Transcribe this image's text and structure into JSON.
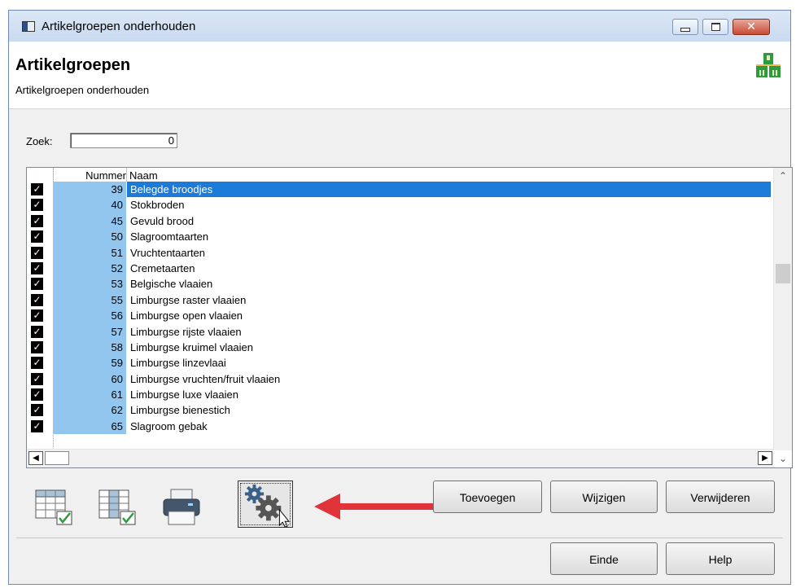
{
  "window": {
    "title": "Artikelgroepen onderhouden"
  },
  "header": {
    "title": "Artikelgroepen",
    "subtitle": "Artikelgroepen onderhouden"
  },
  "search": {
    "label": "Zoek:",
    "value": "0"
  },
  "table": {
    "columns": [
      "Nummer",
      "Naam"
    ],
    "rows": [
      {
        "checked": true,
        "nummer": "39",
        "naam": "Belegde broodjes",
        "selected": true
      },
      {
        "checked": true,
        "nummer": "40",
        "naam": "Stokbroden"
      },
      {
        "checked": true,
        "nummer": "45",
        "naam": "Gevuld brood"
      },
      {
        "checked": true,
        "nummer": "50",
        "naam": "Slagroomtaarten"
      },
      {
        "checked": true,
        "nummer": "51",
        "naam": "Vruchtentaarten"
      },
      {
        "checked": true,
        "nummer": "52",
        "naam": "Cremetaarten"
      },
      {
        "checked": true,
        "nummer": "53",
        "naam": "Belgische vlaaien"
      },
      {
        "checked": true,
        "nummer": "55",
        "naam": "Limburgse raster vlaaien"
      },
      {
        "checked": true,
        "nummer": "56",
        "naam": "Limburgse open vlaaien"
      },
      {
        "checked": true,
        "nummer": "57",
        "naam": "Limburgse rijste vlaaien"
      },
      {
        "checked": true,
        "nummer": "58",
        "naam": "Limburgse kruimel vlaaien"
      },
      {
        "checked": true,
        "nummer": "59",
        "naam": "Limburgse linzevlaai"
      },
      {
        "checked": true,
        "nummer": "60",
        "naam": "Limburgse vruchten/fruit vlaaien"
      },
      {
        "checked": true,
        "nummer": "61",
        "naam": "Limburgse luxe vlaaien"
      },
      {
        "checked": true,
        "nummer": "62",
        "naam": "Limburgse bienestich"
      },
      {
        "checked": true,
        "nummer": "65",
        "naam": "Slagroom gebak"
      }
    ]
  },
  "toolbar": {
    "icons": [
      "grid-rows-check-icon",
      "grid-columns-check-icon",
      "printer-icon",
      "settings-gears-icon"
    ]
  },
  "buttons": {
    "add": "Toevoegen",
    "edit": "Wijzigen",
    "delete": "Verwijderen",
    "end": "Einde",
    "help": "Help"
  },
  "colors": {
    "selection": "#1c7ad8",
    "number_column": "#92c6ee",
    "annotation_arrow": "#e0343a",
    "logo_green": "#2f9b3c"
  }
}
